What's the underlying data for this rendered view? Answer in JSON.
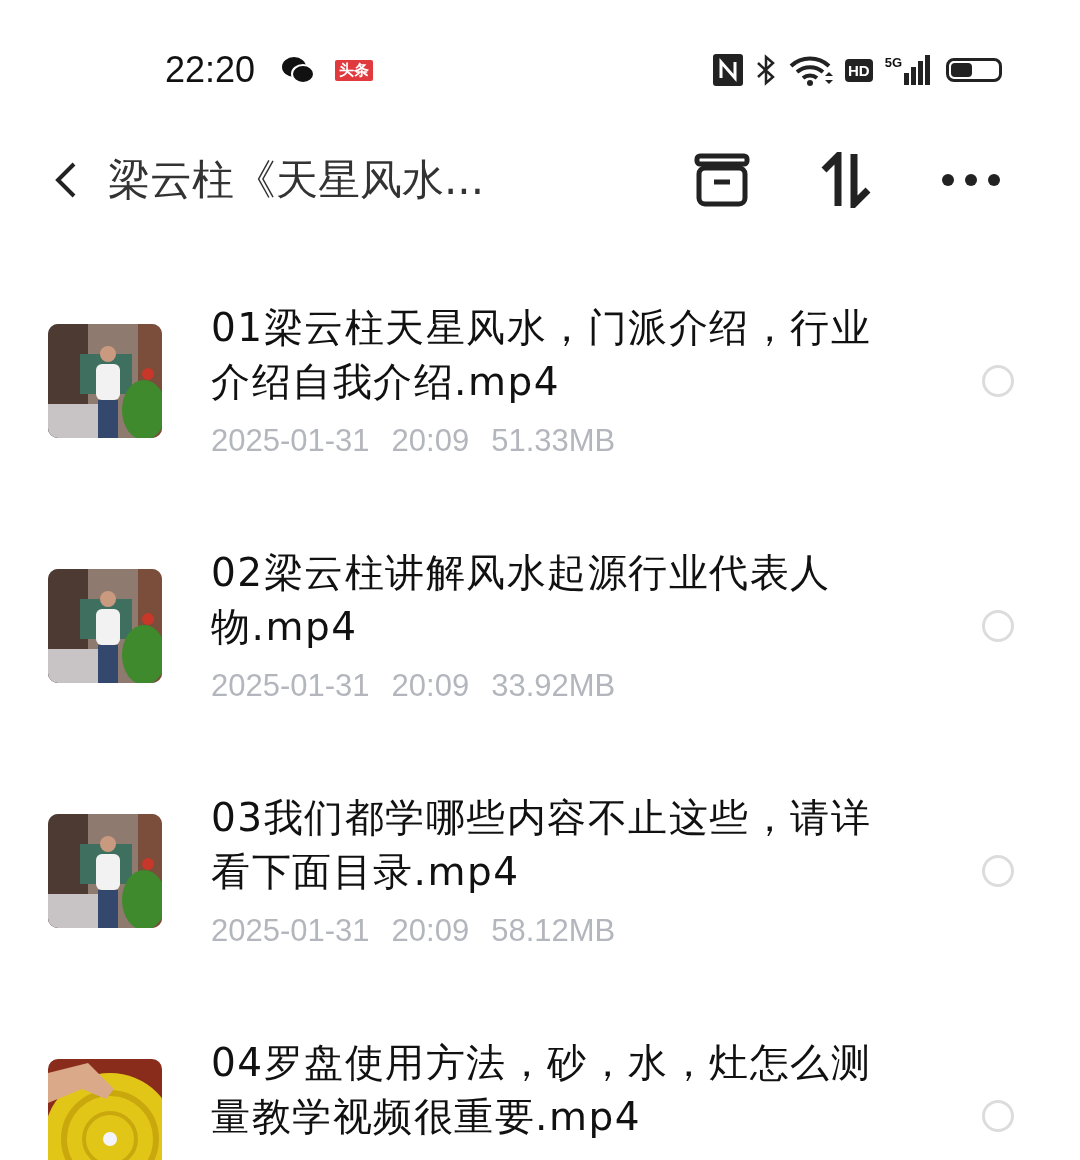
{
  "status_bar": {
    "time": "22:20",
    "news_badge": "头条",
    "hd": "HD",
    "network": "5G",
    "battery": {
      "level": 0.45
    }
  },
  "header": {
    "title": "梁云柱《天星风水..."
  },
  "files": [
    {
      "name": "01梁云柱天星风水，门派介绍，行业介绍自我介绍.mp4",
      "date": "2025-01-31",
      "time": "20:09",
      "size": "51.33MB",
      "selected": false
    },
    {
      "name": "02梁云柱讲解风水起源行业代表人物.mp4",
      "date": "2025-01-31",
      "time": "20:09",
      "size": "33.92MB",
      "selected": false
    },
    {
      "name": "03我们都学哪些内容不止这些，请详看下面目录.mp4",
      "date": "2025-01-31",
      "time": "20:09",
      "size": "58.12MB",
      "selected": false
    },
    {
      "name": "04罗盘使用方法，砂，水，灶怎么测量教学视频很重要.mp4",
      "selected": false
    }
  ]
}
